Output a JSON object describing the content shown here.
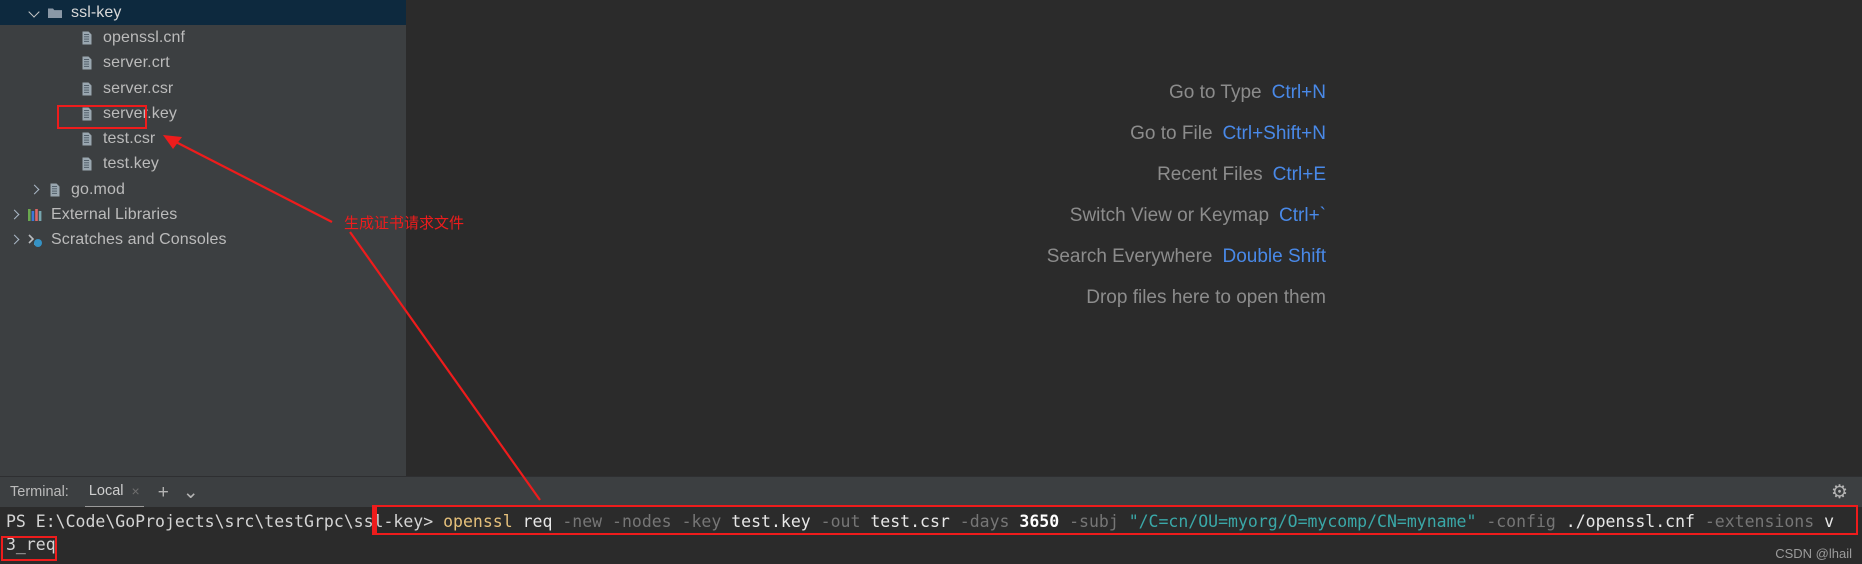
{
  "sidebar": {
    "items": [
      {
        "label": "ssl-key",
        "icon": "folder-icon",
        "arrow": "down",
        "indent": 28,
        "selected": true
      },
      {
        "label": "openssl.cnf",
        "icon": "file-icon",
        "arrow": "none",
        "indent": 60,
        "selected": false
      },
      {
        "label": "server.crt",
        "icon": "file-icon",
        "arrow": "none",
        "indent": 60,
        "selected": false
      },
      {
        "label": "server.csr",
        "icon": "file-icon",
        "arrow": "none",
        "indent": 60,
        "selected": false
      },
      {
        "label": "server.key",
        "icon": "file-icon",
        "arrow": "none",
        "indent": 60,
        "selected": false
      },
      {
        "label": "test.csr",
        "icon": "file-icon",
        "arrow": "none",
        "indent": 60,
        "selected": false
      },
      {
        "label": "test.key",
        "icon": "file-icon",
        "arrow": "none",
        "indent": 60,
        "selected": false
      },
      {
        "label": "go.mod",
        "icon": "file-icon",
        "arrow": "right",
        "indent": 28,
        "selected": false
      },
      {
        "label": "External Libraries",
        "icon": "library-icon",
        "arrow": "right",
        "indent": 8,
        "selected": false
      },
      {
        "label": "Scratches and Consoles",
        "icon": "scratches-icon",
        "arrow": "right",
        "indent": 8,
        "selected": false
      }
    ]
  },
  "editor": {
    "shortcuts": [
      {
        "label": "Go to Type",
        "key": "Ctrl+N"
      },
      {
        "label": "Go to File",
        "key": "Ctrl+Shift+N"
      },
      {
        "label": "Recent Files",
        "key": "Ctrl+E"
      },
      {
        "label": "Switch View or Keymap",
        "key": "Ctrl+`"
      },
      {
        "label": "Search Everywhere",
        "key": "Double Shift"
      },
      {
        "label": "Drop files here to open them",
        "key": ""
      }
    ]
  },
  "terminal": {
    "title": "Terminal:",
    "tab_label": "Local",
    "tab_close": "×",
    "add_label": "+",
    "dropdown_label": "⌄",
    "gear_label": "⚙",
    "prompt": "PS E:\\Code\\GoProjects\\src\\testGrpc\\ssl-key>",
    "command_tokens": [
      {
        "text": "openssl",
        "type": "cmd"
      },
      {
        "text": "req",
        "type": "sub"
      },
      {
        "text": "-new",
        "type": "opt"
      },
      {
        "text": "-nodes",
        "type": "opt"
      },
      {
        "text": "-key",
        "type": "opt"
      },
      {
        "text": "test.key",
        "type": "arg"
      },
      {
        "text": "-out",
        "type": "opt"
      },
      {
        "text": "test.csr",
        "type": "arg"
      },
      {
        "text": "-days",
        "type": "opt"
      },
      {
        "text": "3650",
        "type": "num"
      },
      {
        "text": "-subj",
        "type": "opt"
      },
      {
        "text": "\"/C=cn/OU=myorg/O=mycomp/CN=myname\"",
        "type": "str"
      },
      {
        "text": "-config",
        "type": "opt"
      },
      {
        "text": "./openssl.cnf",
        "type": "arg"
      },
      {
        "text": "-extensions",
        "type": "opt"
      },
      {
        "text": "v",
        "type": "arg"
      }
    ],
    "command_line2": "3_req"
  },
  "annotations": {
    "note_text": "生成证书请求文件",
    "watermark": "CSDN @lhail",
    "accent_red": "#ee1c1c",
    "accent_blue": "#4989e8"
  }
}
